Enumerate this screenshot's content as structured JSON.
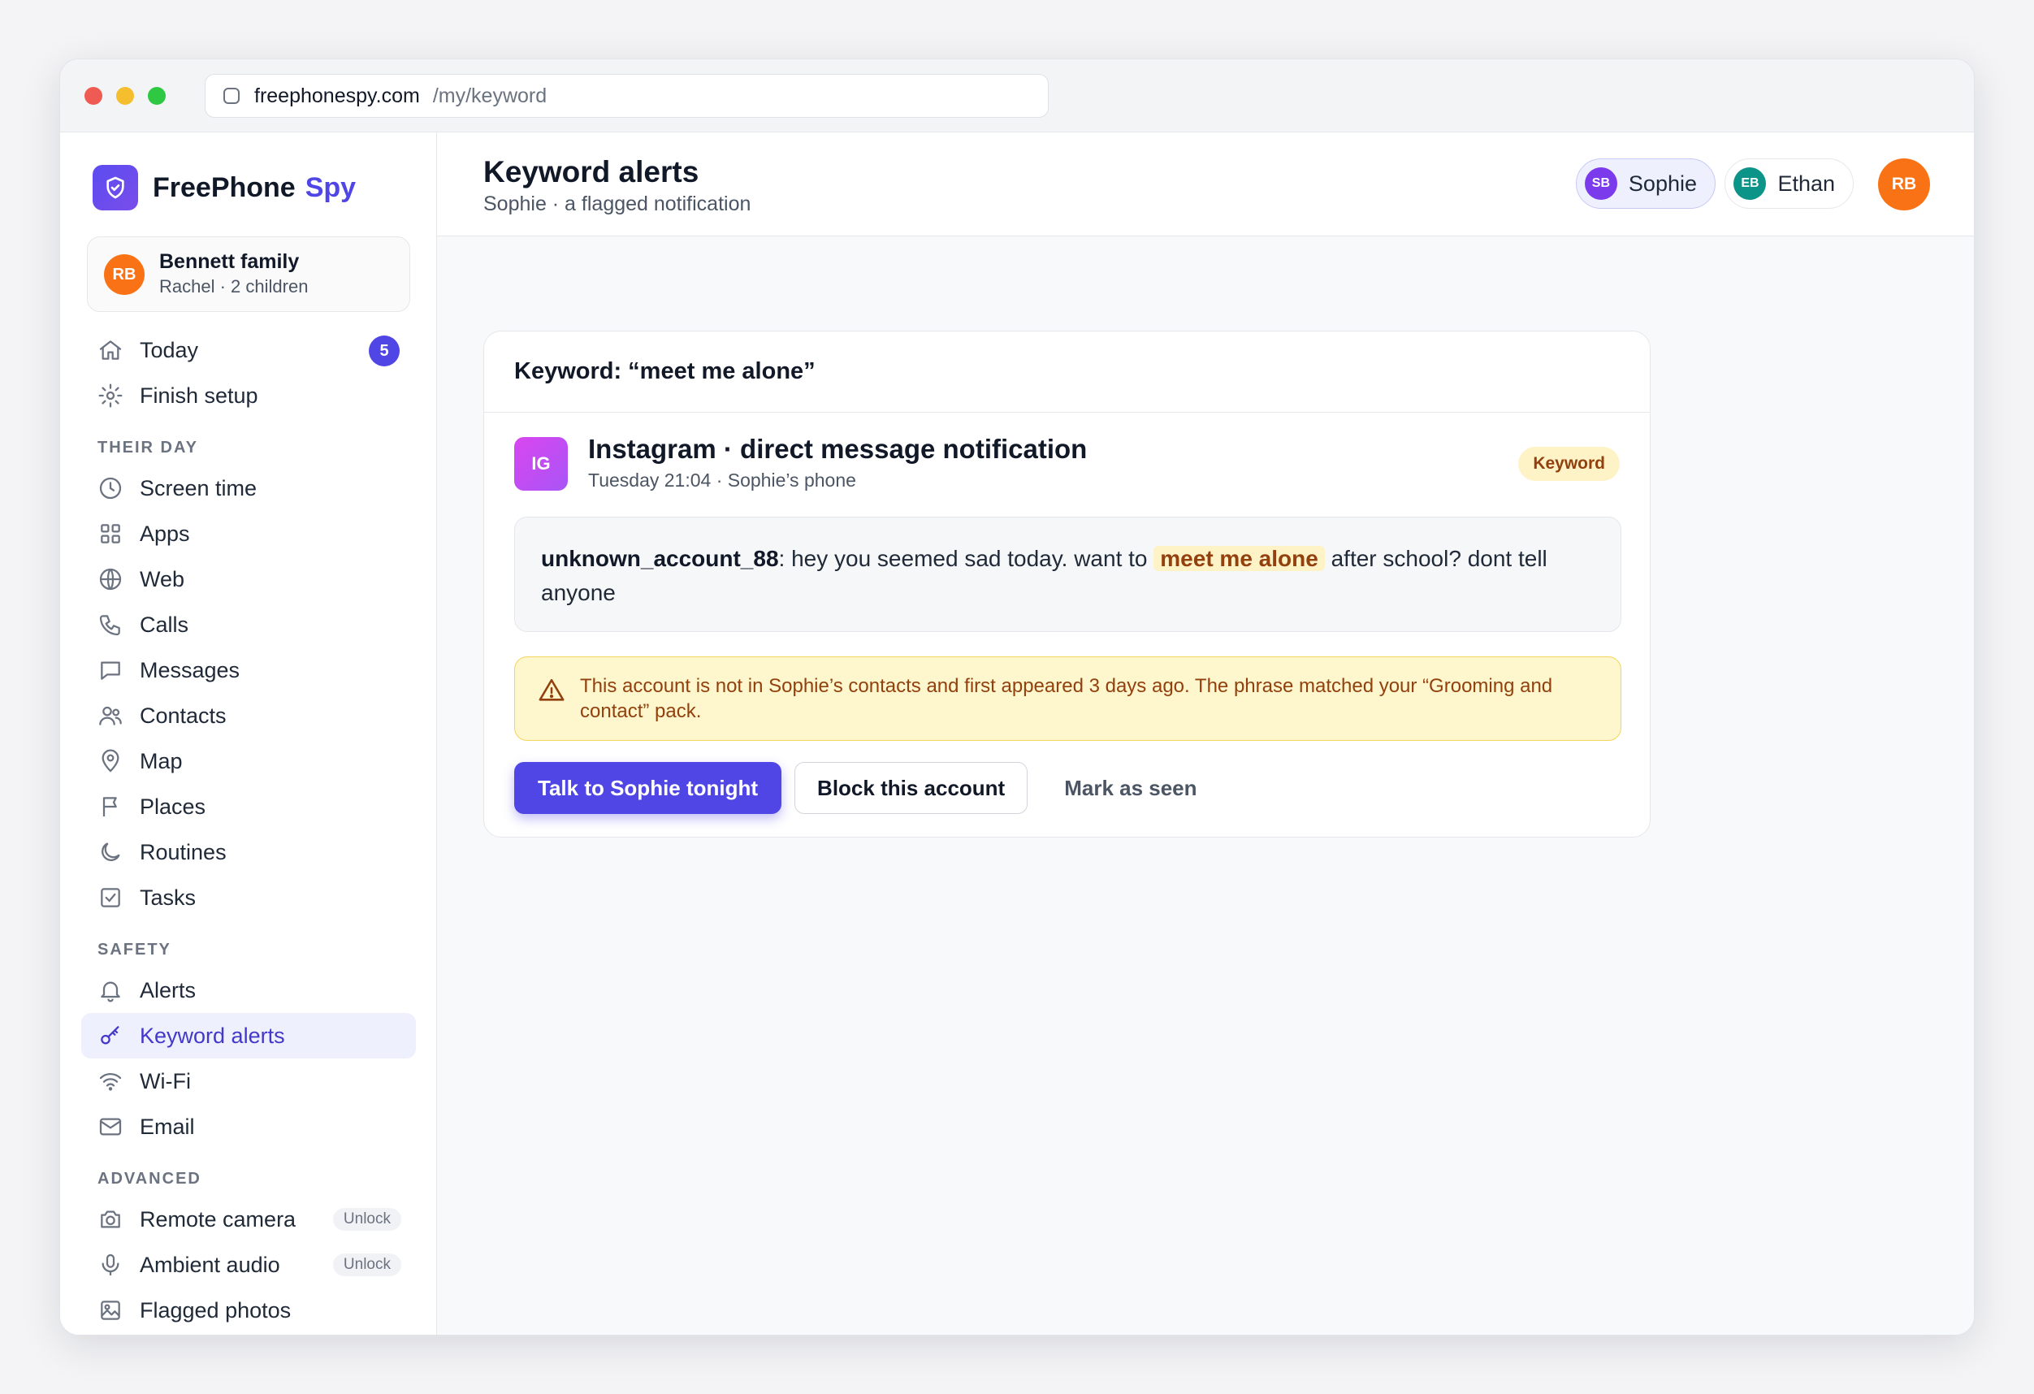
{
  "browser": {
    "host": "freephonespy.com",
    "path": "/my/keyword"
  },
  "brand": {
    "name": "FreePhone",
    "accent": "Spy"
  },
  "family": {
    "initials": "RB",
    "name": "Bennett family",
    "subtitle": "Rachel · 2 children"
  },
  "nav": {
    "top": [
      {
        "label": "Today",
        "badge": "5"
      },
      {
        "label": "Finish setup"
      }
    ],
    "sections": {
      "their_day": "THEIR DAY",
      "safety": "SAFETY",
      "advanced": "ADVANCED"
    },
    "their_day": [
      "Screen time",
      "Apps",
      "Web",
      "Calls",
      "Messages",
      "Contacts",
      "Map",
      "Places",
      "Routines",
      "Tasks"
    ],
    "safety": [
      "Alerts",
      "Keyword alerts",
      "Wi-Fi",
      "Email"
    ],
    "advanced": [
      {
        "label": "Remote camera",
        "pill": "Unlock"
      },
      {
        "label": "Ambient audio",
        "pill": "Unlock"
      },
      {
        "label": "Flagged photos"
      }
    ]
  },
  "header": {
    "title": "Keyword alerts",
    "subtitle": "Sophie · a flagged notification",
    "children": [
      {
        "initials": "SB",
        "name": "Sophie",
        "color": "#7c3aed"
      },
      {
        "initials": "EB",
        "name": "Ethan",
        "color": "#0d9488"
      }
    ],
    "user_initials": "RB"
  },
  "alert": {
    "title": "Keyword: “meet me alone”",
    "source_icon": "IG",
    "source_title": "Instagram · direct message notification",
    "source_meta": "Tuesday 21:04 · Sophie’s phone",
    "badge": "Keyword",
    "message": {
      "sender": "unknown_account_88",
      "before": ": hey you seemed sad today. want to ",
      "highlight": "meet me alone",
      "after": " after school? dont tell anyone"
    },
    "warning": "This account is not in Sophie’s contacts and first appeared 3 days ago. The phrase matched your “Grooming and contact” pack.",
    "actions": {
      "primary": "Talk to Sophie tonight",
      "secondary": "Block this account",
      "tertiary": "Mark as seen"
    }
  },
  "colors": {
    "accent": "#4f46e5",
    "avatar_orange": "#f97316",
    "warning_bg": "#fef7cd"
  }
}
